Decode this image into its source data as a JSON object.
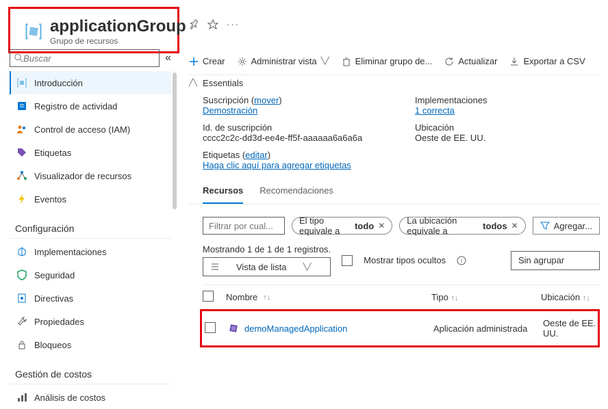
{
  "header": {
    "title": "applicationGroup",
    "subtitle": "Grupo de recursos"
  },
  "sidebar": {
    "search_placeholder": "Buscar",
    "items": [
      {
        "label": "Introducción"
      },
      {
        "label": "Registro de actividad"
      },
      {
        "label": "Control de acceso (IAM)"
      },
      {
        "label": "Etiquetas"
      },
      {
        "label": "Visualizador de recursos"
      },
      {
        "label": "Eventos"
      }
    ],
    "section_config": "Configuración",
    "config_items": [
      {
        "label": "Implementaciones"
      },
      {
        "label": "Seguridad"
      },
      {
        "label": "Directivas"
      },
      {
        "label": "Propiedades"
      },
      {
        "label": "Bloqueos"
      }
    ],
    "section_cost": "Gestión de costos",
    "cost_items": [
      {
        "label": "Análisis de costos"
      }
    ]
  },
  "toolbar": {
    "create": "Crear",
    "manage_view": "Administrar vista",
    "delete": "Eliminar grupo de...",
    "refresh": "Actualizar",
    "export": "Exportar a CSV"
  },
  "essentials": {
    "title": "Essentials",
    "sub_label": "Suscripción",
    "sub_move": "mover",
    "sub_value": "Demostración",
    "subid_label": "Id. de suscripción",
    "subid_value": "cccc2c2c-dd3d-ee4e-ff5f-aaaaaa6a6a6a",
    "tags_label": "Etiquetas",
    "tags_edit": "editar",
    "tags_value": "Haga clic aquí para agregar etiquetas",
    "deploy_label": "Implementaciones",
    "deploy_value": "1 correcta",
    "loc_label": "Ubicación",
    "loc_value": "Oeste de EE. UU."
  },
  "tabs": {
    "resources": "Recursos",
    "recommendations": "Recomendaciones"
  },
  "filters": {
    "filter_placeholder": "Filtrar por cual...",
    "type_prefix": "El tipo equivale a ",
    "type_value": "todo",
    "loc_prefix": "La ubicación equivale a ",
    "loc_value": "todos",
    "add": "Agregar..."
  },
  "listopts": {
    "count_text": "Mostrando 1 de 1 de 1 registros.",
    "view_list": "Vista de lista",
    "show_hidden": "Mostrar tipos ocultos",
    "group_none": "Sin agrupar"
  },
  "table": {
    "col_name": "Nombre",
    "col_type": "Tipo",
    "col_loc": "Ubicación",
    "rows": [
      {
        "name": "demoManagedApplication",
        "type": "Aplicación administrada",
        "loc": "Oeste de EE. UU."
      }
    ]
  }
}
